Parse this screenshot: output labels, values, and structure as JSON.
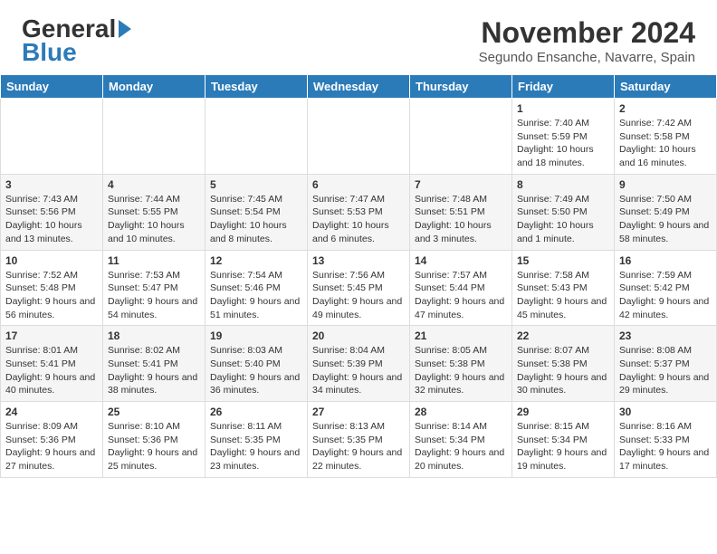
{
  "header": {
    "title": "November 2024",
    "subtitle": "Segundo Ensanche, Navarre, Spain",
    "logo_line1": "General",
    "logo_line2": "Blue"
  },
  "days_of_week": [
    "Sunday",
    "Monday",
    "Tuesday",
    "Wednesday",
    "Thursday",
    "Friday",
    "Saturday"
  ],
  "weeks": [
    [
      {
        "day": "",
        "info": ""
      },
      {
        "day": "",
        "info": ""
      },
      {
        "day": "",
        "info": ""
      },
      {
        "day": "",
        "info": ""
      },
      {
        "day": "",
        "info": ""
      },
      {
        "day": "1",
        "info": "Sunrise: 7:40 AM\nSunset: 5:59 PM\nDaylight: 10 hours and 18 minutes."
      },
      {
        "day": "2",
        "info": "Sunrise: 7:42 AM\nSunset: 5:58 PM\nDaylight: 10 hours and 16 minutes."
      }
    ],
    [
      {
        "day": "3",
        "info": "Sunrise: 7:43 AM\nSunset: 5:56 PM\nDaylight: 10 hours and 13 minutes."
      },
      {
        "day": "4",
        "info": "Sunrise: 7:44 AM\nSunset: 5:55 PM\nDaylight: 10 hours and 10 minutes."
      },
      {
        "day": "5",
        "info": "Sunrise: 7:45 AM\nSunset: 5:54 PM\nDaylight: 10 hours and 8 minutes."
      },
      {
        "day": "6",
        "info": "Sunrise: 7:47 AM\nSunset: 5:53 PM\nDaylight: 10 hours and 6 minutes."
      },
      {
        "day": "7",
        "info": "Sunrise: 7:48 AM\nSunset: 5:51 PM\nDaylight: 10 hours and 3 minutes."
      },
      {
        "day": "8",
        "info": "Sunrise: 7:49 AM\nSunset: 5:50 PM\nDaylight: 10 hours and 1 minute."
      },
      {
        "day": "9",
        "info": "Sunrise: 7:50 AM\nSunset: 5:49 PM\nDaylight: 9 hours and 58 minutes."
      }
    ],
    [
      {
        "day": "10",
        "info": "Sunrise: 7:52 AM\nSunset: 5:48 PM\nDaylight: 9 hours and 56 minutes."
      },
      {
        "day": "11",
        "info": "Sunrise: 7:53 AM\nSunset: 5:47 PM\nDaylight: 9 hours and 54 minutes."
      },
      {
        "day": "12",
        "info": "Sunrise: 7:54 AM\nSunset: 5:46 PM\nDaylight: 9 hours and 51 minutes."
      },
      {
        "day": "13",
        "info": "Sunrise: 7:56 AM\nSunset: 5:45 PM\nDaylight: 9 hours and 49 minutes."
      },
      {
        "day": "14",
        "info": "Sunrise: 7:57 AM\nSunset: 5:44 PM\nDaylight: 9 hours and 47 minutes."
      },
      {
        "day": "15",
        "info": "Sunrise: 7:58 AM\nSunset: 5:43 PM\nDaylight: 9 hours and 45 minutes."
      },
      {
        "day": "16",
        "info": "Sunrise: 7:59 AM\nSunset: 5:42 PM\nDaylight: 9 hours and 42 minutes."
      }
    ],
    [
      {
        "day": "17",
        "info": "Sunrise: 8:01 AM\nSunset: 5:41 PM\nDaylight: 9 hours and 40 minutes."
      },
      {
        "day": "18",
        "info": "Sunrise: 8:02 AM\nSunset: 5:41 PM\nDaylight: 9 hours and 38 minutes."
      },
      {
        "day": "19",
        "info": "Sunrise: 8:03 AM\nSunset: 5:40 PM\nDaylight: 9 hours and 36 minutes."
      },
      {
        "day": "20",
        "info": "Sunrise: 8:04 AM\nSunset: 5:39 PM\nDaylight: 9 hours and 34 minutes."
      },
      {
        "day": "21",
        "info": "Sunrise: 8:05 AM\nSunset: 5:38 PM\nDaylight: 9 hours and 32 minutes."
      },
      {
        "day": "22",
        "info": "Sunrise: 8:07 AM\nSunset: 5:38 PM\nDaylight: 9 hours and 30 minutes."
      },
      {
        "day": "23",
        "info": "Sunrise: 8:08 AM\nSunset: 5:37 PM\nDaylight: 9 hours and 29 minutes."
      }
    ],
    [
      {
        "day": "24",
        "info": "Sunrise: 8:09 AM\nSunset: 5:36 PM\nDaylight: 9 hours and 27 minutes."
      },
      {
        "day": "25",
        "info": "Sunrise: 8:10 AM\nSunset: 5:36 PM\nDaylight: 9 hours and 25 minutes."
      },
      {
        "day": "26",
        "info": "Sunrise: 8:11 AM\nSunset: 5:35 PM\nDaylight: 9 hours and 23 minutes."
      },
      {
        "day": "27",
        "info": "Sunrise: 8:13 AM\nSunset: 5:35 PM\nDaylight: 9 hours and 22 minutes."
      },
      {
        "day": "28",
        "info": "Sunrise: 8:14 AM\nSunset: 5:34 PM\nDaylight: 9 hours and 20 minutes."
      },
      {
        "day": "29",
        "info": "Sunrise: 8:15 AM\nSunset: 5:34 PM\nDaylight: 9 hours and 19 minutes."
      },
      {
        "day": "30",
        "info": "Sunrise: 8:16 AM\nSunset: 5:33 PM\nDaylight: 9 hours and 17 minutes."
      }
    ]
  ]
}
